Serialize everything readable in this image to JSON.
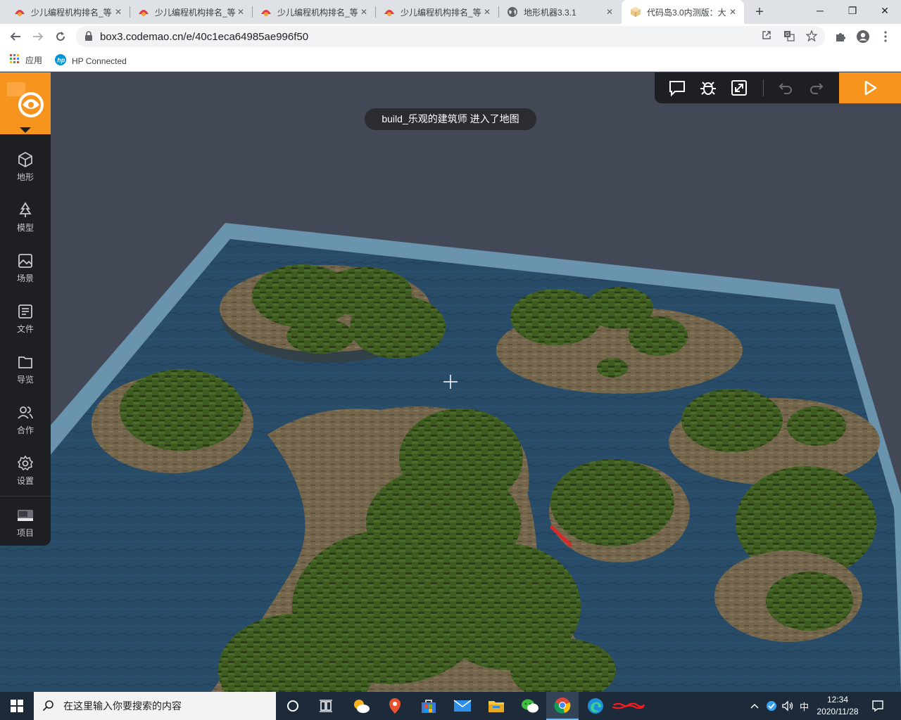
{
  "browser": {
    "tabs": [
      {
        "title": "少儿编程机构排名_等",
        "icon": "codemao-icon",
        "active": false
      },
      {
        "title": "少儿编程机构排名_等",
        "icon": "codemao-icon",
        "active": false
      },
      {
        "title": "少儿编程机构排名_等",
        "icon": "codemao-icon",
        "active": false
      },
      {
        "title": "少儿编程机构排名_等",
        "icon": "codemao-icon",
        "active": false
      },
      {
        "title": "地形机器3.3.1",
        "icon": "globe-icon",
        "active": false
      },
      {
        "title": "代码岛3.0内测版：大",
        "icon": "box3-icon",
        "active": true
      }
    ],
    "url": "box3.codemao.cn/e/40c1eca64985ae996f50",
    "bookmarks": [
      {
        "label": "应用",
        "icon": "apps-grid-icon"
      },
      {
        "label": "HP Connected",
        "icon": "hp-icon"
      }
    ]
  },
  "app": {
    "sidebar": [
      {
        "label": "地形",
        "icon": "cube-icon"
      },
      {
        "label": "模型",
        "icon": "tree-icon"
      },
      {
        "label": "场景",
        "icon": "image-icon"
      },
      {
        "label": "文件",
        "icon": "file-list-icon"
      },
      {
        "label": "导览",
        "icon": "folder-icon"
      },
      {
        "label": "合作",
        "icon": "users-icon"
      },
      {
        "label": "设置",
        "icon": "gear-icon"
      },
      {
        "label": "项目",
        "icon": "project-thumbnail-icon"
      }
    ],
    "toolbar": [
      "chat-icon",
      "debug-bug-icon",
      "expand-icon",
      "undo-icon",
      "redo-icon",
      "play-icon"
    ],
    "toast": "build_乐观的建筑师 进入了地图",
    "colors": {
      "accent": "#f7941d",
      "panel": "#1e1f22",
      "sky": "#424856",
      "water": "#2a4d66",
      "sand": "#7a6a50",
      "grass": "#3d5a22"
    }
  },
  "taskbar": {
    "search_placeholder": "在这里输入你要搜索的内容",
    "ime": "中",
    "time": "12:34",
    "date": "2020/11/28"
  }
}
